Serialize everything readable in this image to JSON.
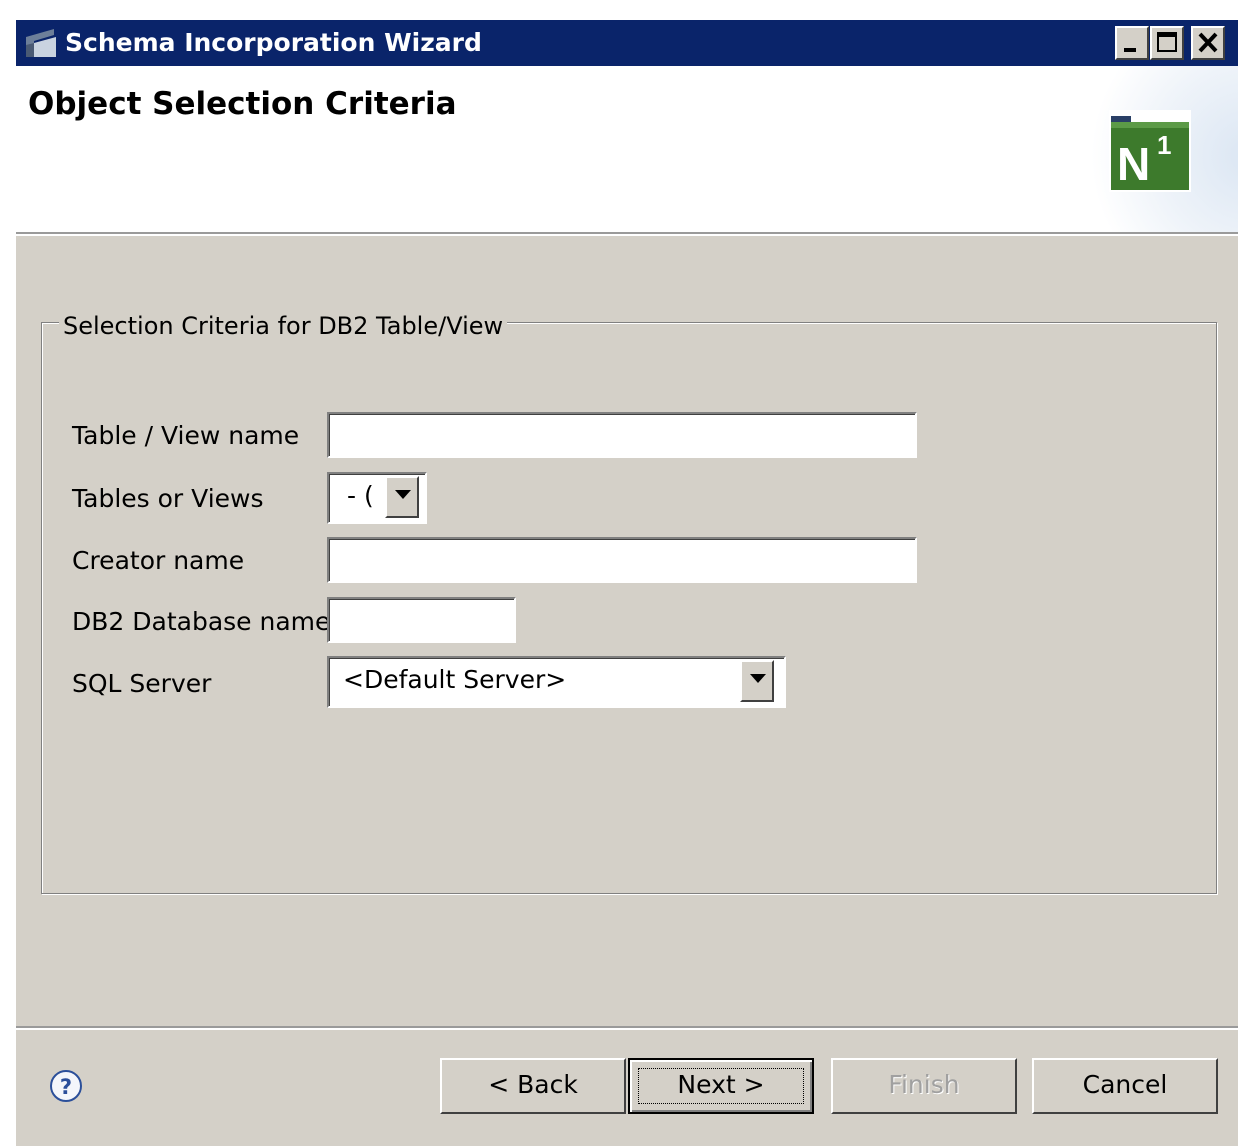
{
  "window": {
    "title": "Schema Incorporation Wizard",
    "controls": [
      "minimize-icon",
      "maximize-icon",
      "close-icon"
    ]
  },
  "header": {
    "title": "Object Selection Criteria",
    "logo_text": "N",
    "logo_superscript": "1"
  },
  "group": {
    "legend": "Selection Criteria for DB2 Table/View"
  },
  "form": {
    "table_view_name": {
      "label": "Table / View name",
      "value": ""
    },
    "tables_or_views": {
      "label": "Tables or Views",
      "value": "- ("
    },
    "creator_name": {
      "label": "Creator name",
      "value": ""
    },
    "db2_database_name": {
      "label": "DB2 Database name",
      "value": ""
    },
    "sql_server": {
      "label": "SQL Server",
      "value": "<Default Server>"
    }
  },
  "buttons": {
    "back": "< Back",
    "next": "Next >",
    "finish": "Finish",
    "cancel": "Cancel"
  },
  "colors": {
    "titlebar": "#0a246a",
    "face": "#d4d0c8",
    "logo": "#3d7a2c"
  }
}
